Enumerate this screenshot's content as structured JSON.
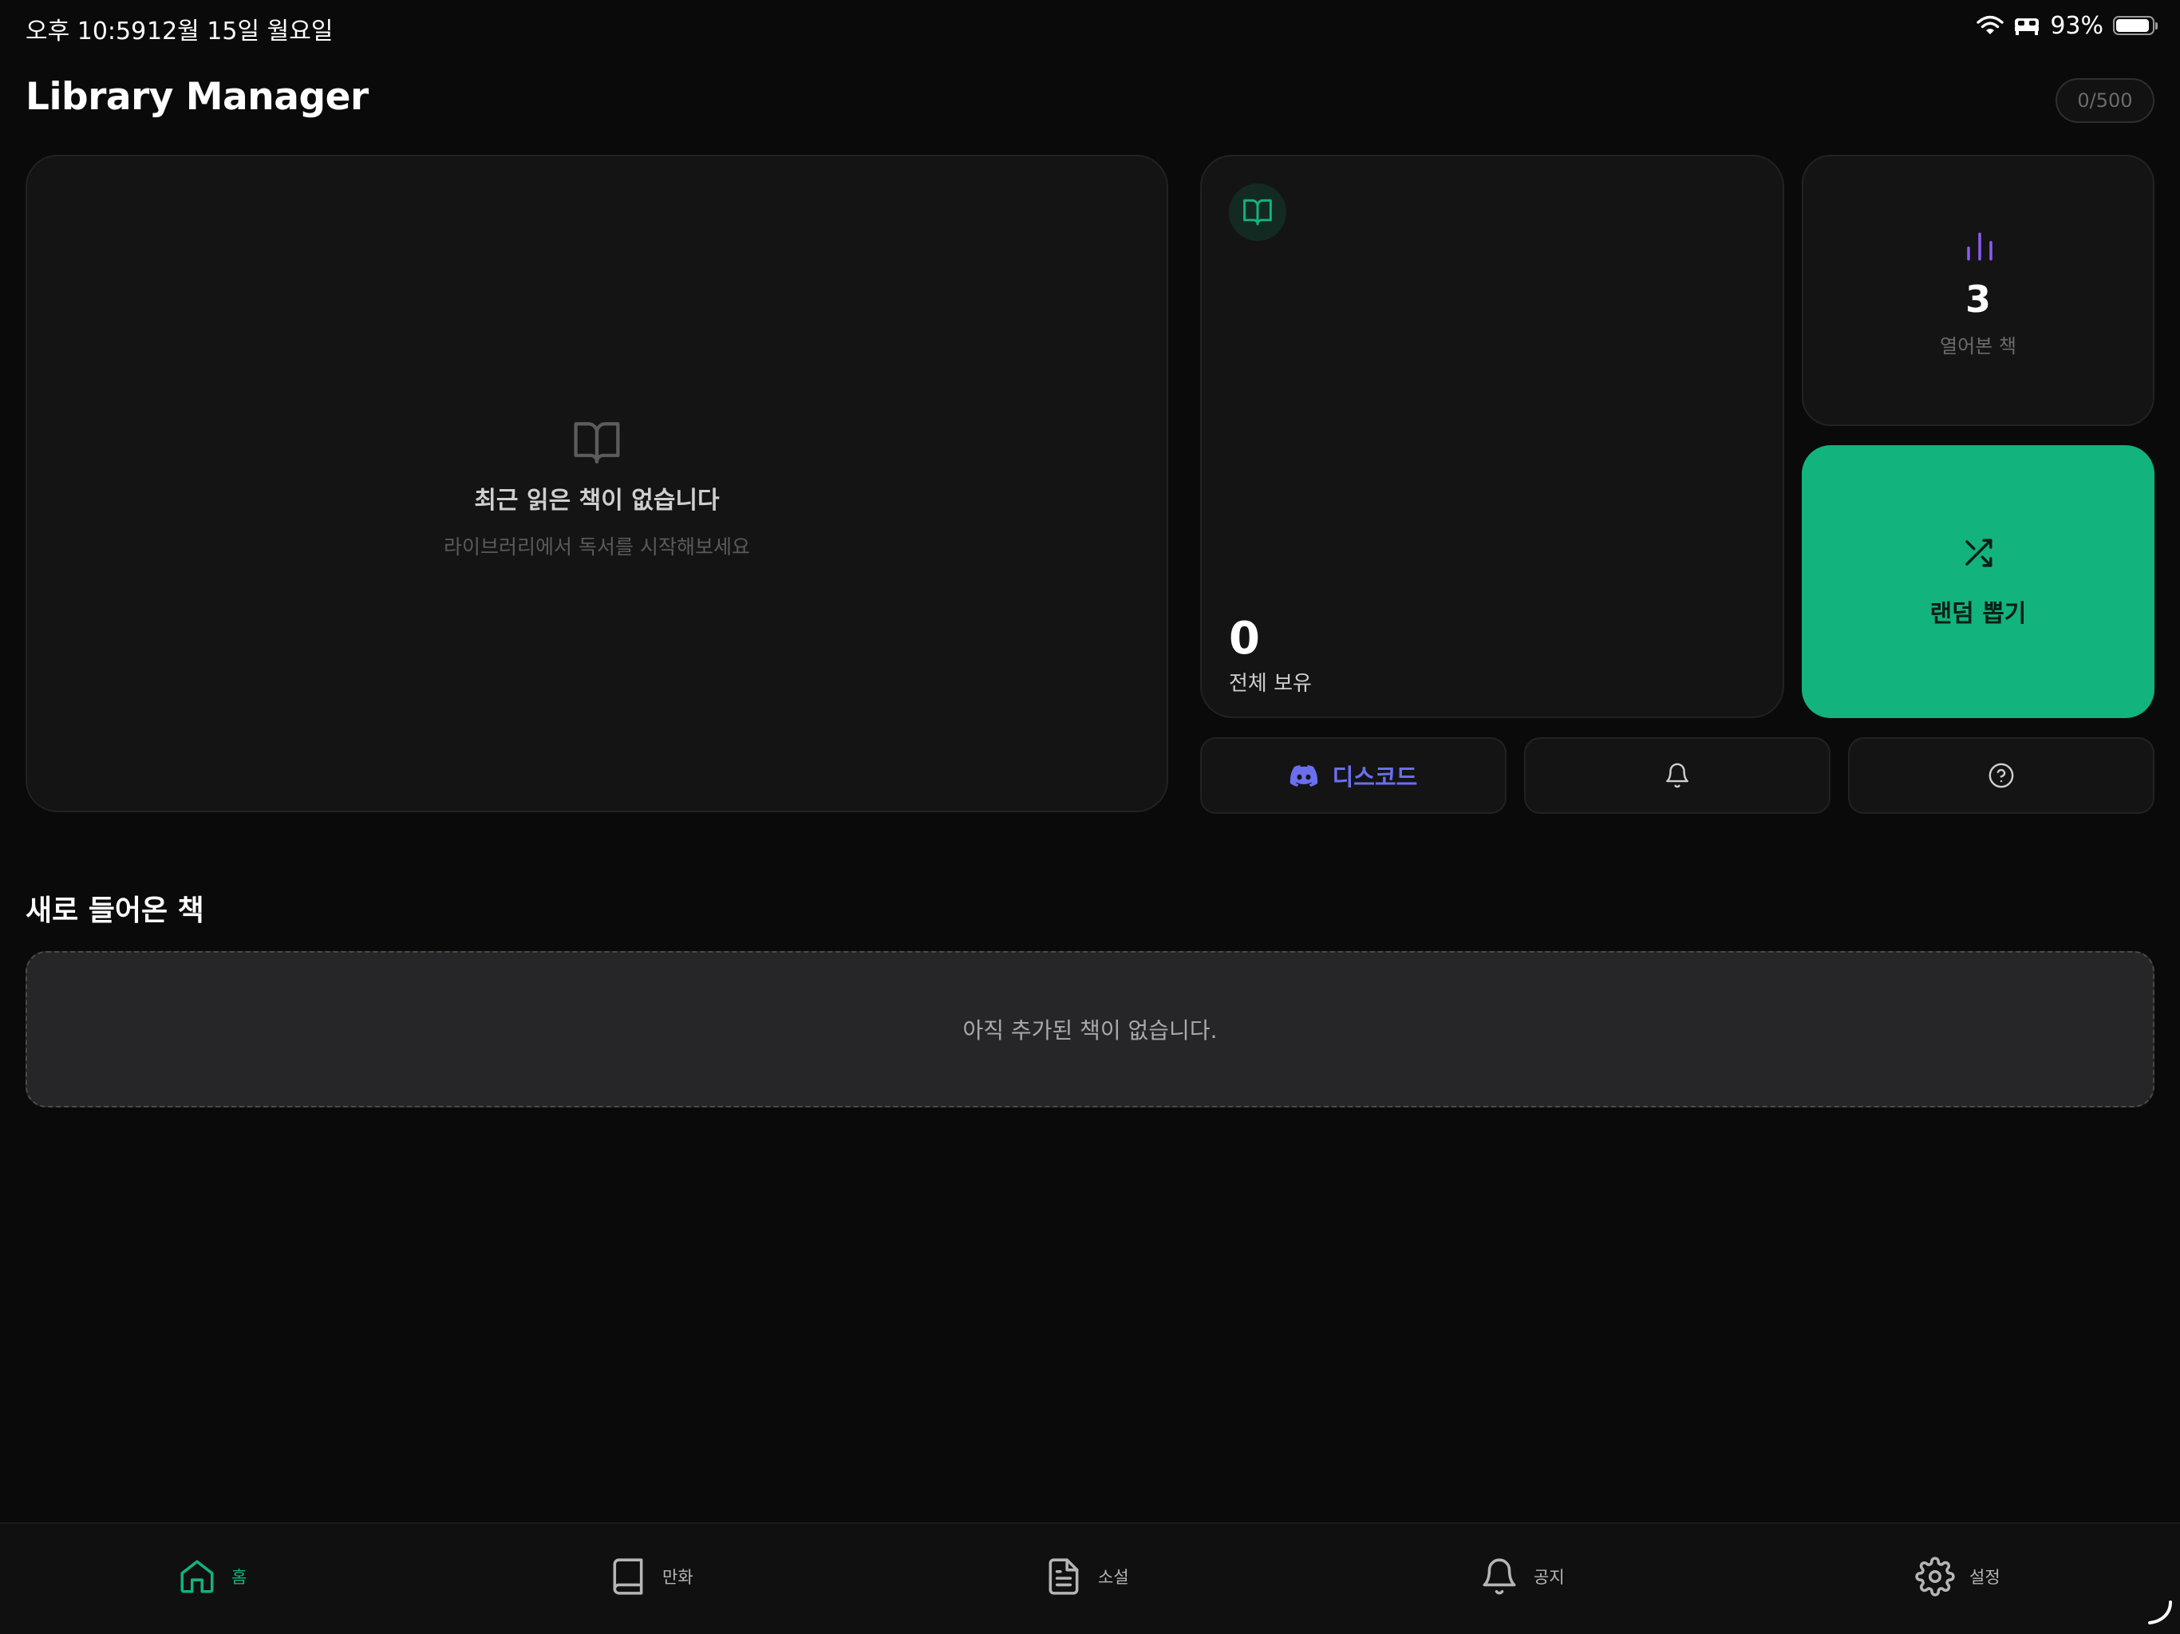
{
  "status_bar": {
    "time": "오후 10:59",
    "date": "12월 15일 월요일",
    "battery_percent": "93%",
    "battery_level": 0.93,
    "icons": [
      "wifi-icon",
      "sleep-mode-icon",
      "battery-icon"
    ]
  },
  "header": {
    "title": "Library Manager",
    "quota": "0/500"
  },
  "recent": {
    "icon": "open-book-icon",
    "title": "최근 읽은 책이 없습니다",
    "subtitle": "라이브러리에서 독서를 시작해보세요"
  },
  "stats": {
    "total": {
      "icon": "open-book-icon",
      "value": "0",
      "label": "전체 보유"
    },
    "opened": {
      "icon": "bar-chart-icon",
      "value": "3",
      "label": "열어본 책"
    }
  },
  "random": {
    "icon": "shuffle-icon",
    "label": "랜덤 뽑기"
  },
  "actions": {
    "discord": {
      "icon": "discord-icon",
      "label": "디스코드"
    },
    "notifications": {
      "icon": "bell-icon"
    },
    "help": {
      "icon": "help-circle-icon"
    }
  },
  "new_books": {
    "title": "새로 들어온 책",
    "empty_message": "아직 추가된 책이 없습니다."
  },
  "tabs": [
    {
      "id": "home",
      "label": "홈",
      "icon": "home-icon",
      "active": true
    },
    {
      "id": "comics",
      "label": "만화",
      "icon": "book-icon",
      "active": false
    },
    {
      "id": "novel",
      "label": "소설",
      "icon": "document-icon",
      "active": false
    },
    {
      "id": "notice",
      "label": "공지",
      "icon": "bell-icon",
      "active": false
    },
    {
      "id": "settings",
      "label": "설정",
      "icon": "gear-icon",
      "active": false
    }
  ],
  "colors": {
    "background": "#0a0a0a",
    "card": "#141414",
    "accent": "#12b37d",
    "purple": "#8b5cf6",
    "discord": "#6a6ff0"
  }
}
